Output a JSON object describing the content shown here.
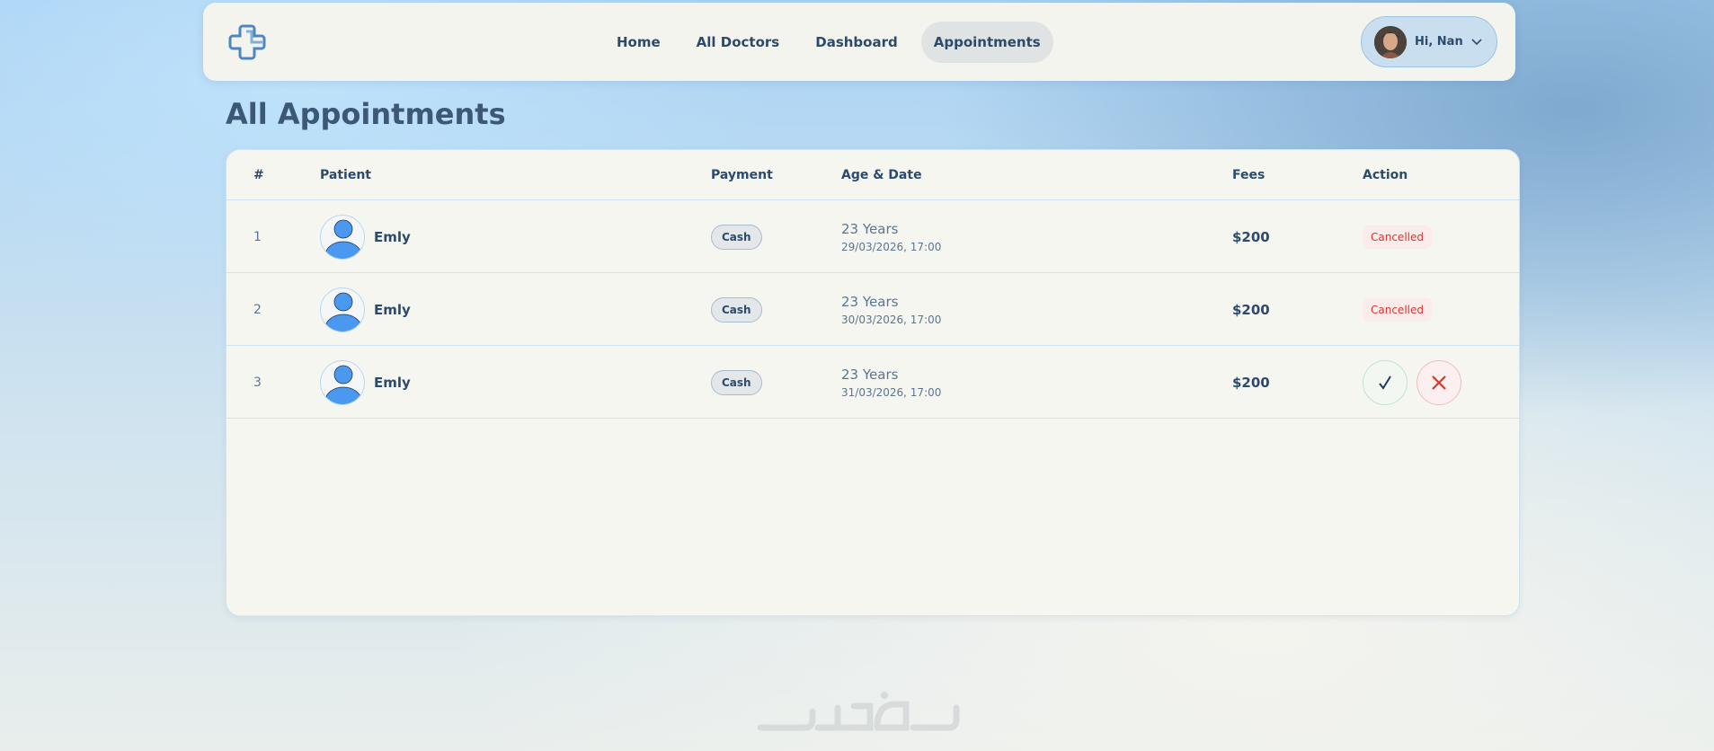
{
  "nav": {
    "links": [
      {
        "label": "Home"
      },
      {
        "label": "All Doctors"
      },
      {
        "label": "Dashboard"
      },
      {
        "label": "Appointments",
        "active": true
      }
    ],
    "user_greeting": "Hi, Nan"
  },
  "page": {
    "title": "All Appointments"
  },
  "table": {
    "columns": [
      "#",
      "Patient",
      "Payment",
      "Age & Date",
      "Fees",
      "Action"
    ],
    "rows": [
      {
        "index": "1",
        "patient": "Emly",
        "payment": "Cash",
        "age": "23 Years",
        "datetime": "29/03/2026, 17:00",
        "fees": "$200",
        "status": "Cancelled"
      },
      {
        "index": "2",
        "patient": "Emly",
        "payment": "Cash",
        "age": "23 Years",
        "datetime": "30/03/2026, 17:00",
        "fees": "$200",
        "status": "Cancelled"
      },
      {
        "index": "3",
        "patient": "Emly",
        "payment": "Cash",
        "age": "23 Years",
        "datetime": "31/03/2026, 17:00",
        "fees": "$200",
        "status": ""
      }
    ]
  },
  "icons": {
    "logo": "medical-cross-logo",
    "chevron": "chevron-down-icon",
    "accept": "check-icon",
    "cancel": "close-icon"
  },
  "colors": {
    "accent": "#2c4a6b",
    "cancelled": "#d6372f",
    "avatar_blue": "#4a98f0",
    "check": "#1f3a5a",
    "close": "#d6372f"
  }
}
